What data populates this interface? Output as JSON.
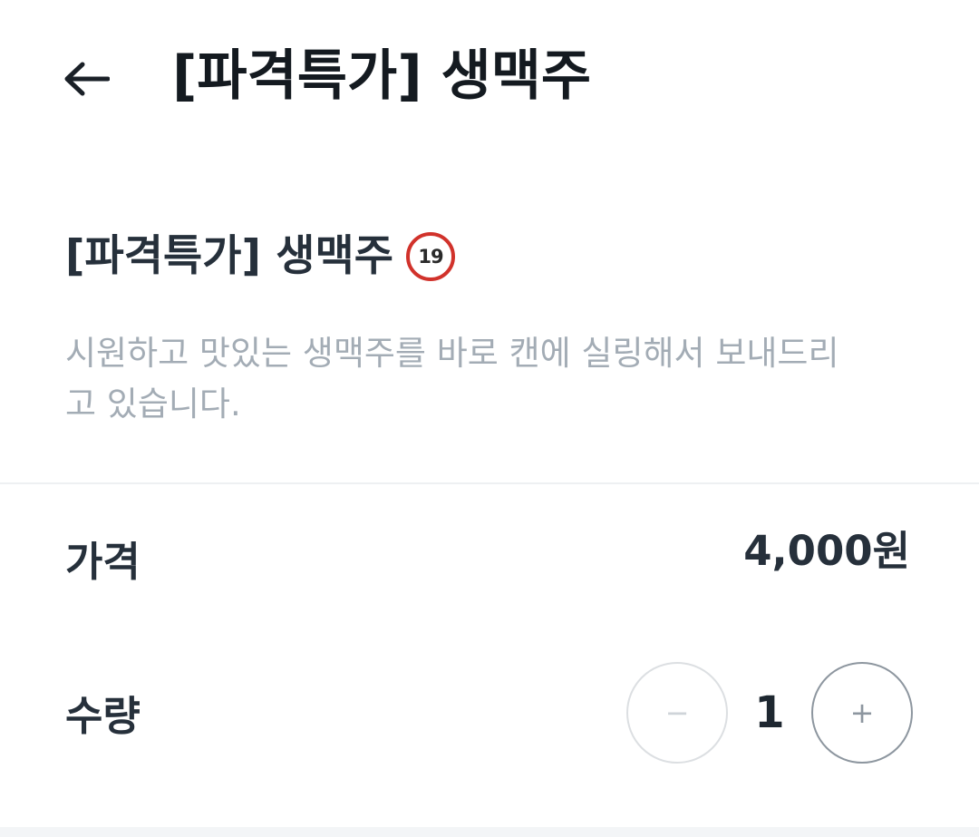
{
  "header": {
    "back_icon": "arrow-left-icon",
    "title": "[파격특가] 생맥주"
  },
  "product": {
    "name": "[파격특가] 생맥주",
    "age_badge": "19",
    "age_badge_color": "#d1322b",
    "description": "시원하고 맛있는 생맥주를 바로 캔에 실링해서 보내드리고 있습니다."
  },
  "price": {
    "label": "가격",
    "value": "4,000원"
  },
  "quantity": {
    "label": "수량",
    "value": "1",
    "minus_label": "−",
    "plus_label": "+"
  }
}
